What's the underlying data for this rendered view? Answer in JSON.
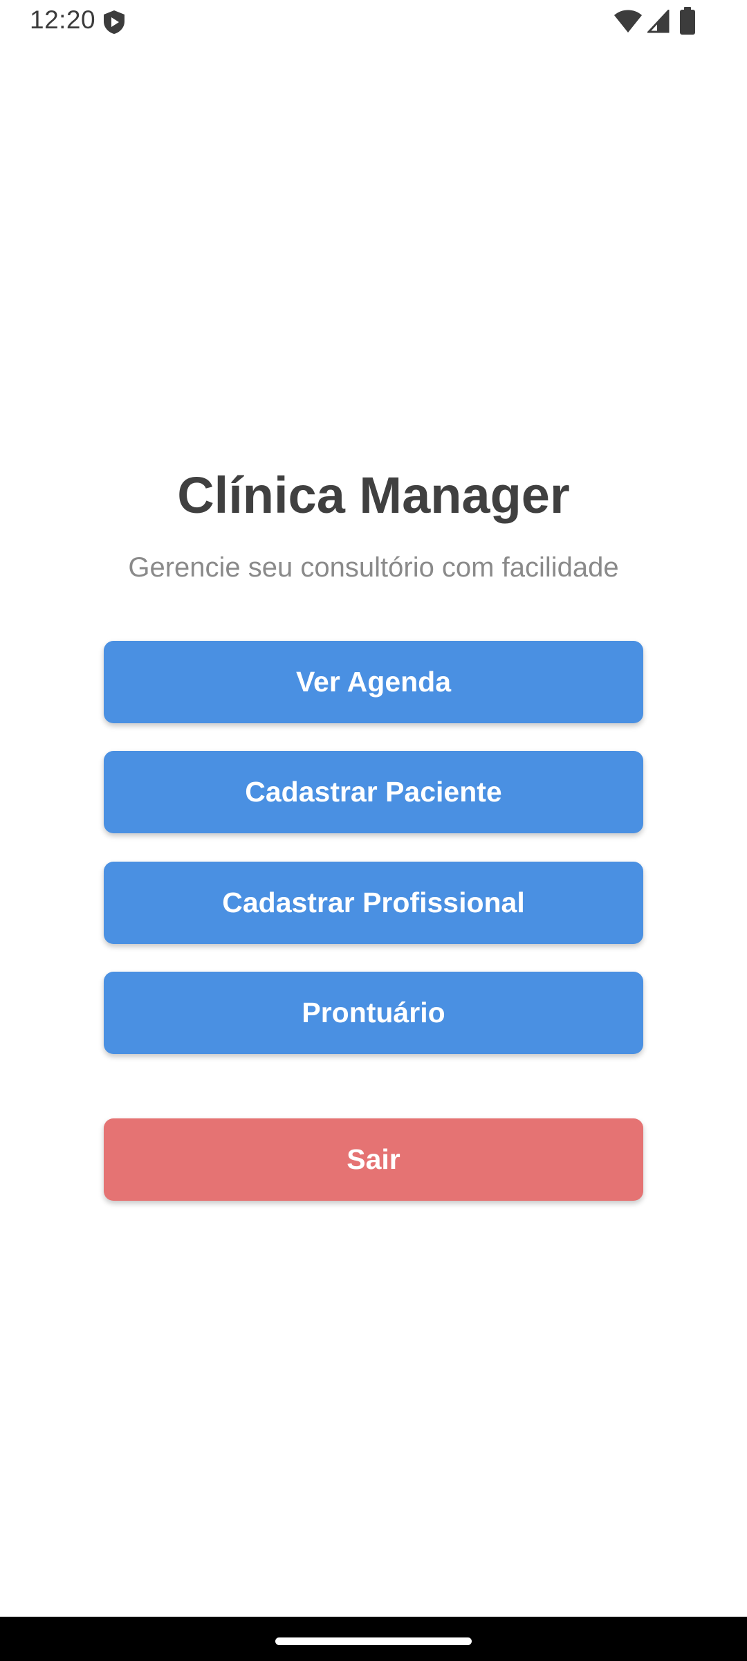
{
  "status_bar": {
    "time": "12:20",
    "icons": [
      "shield-icon",
      "wifi-icon",
      "signal-icon",
      "battery-icon"
    ]
  },
  "app": {
    "title": "Clínica Manager",
    "subtitle": "Gerencie seu consultório com facilidade"
  },
  "menu": {
    "agenda_label": "Ver Agenda",
    "paciente_label": "Cadastrar Paciente",
    "profissional_label": "Cadastrar Profissional",
    "prontuario_label": "Prontuário",
    "sair_label": "Sair"
  },
  "colors": {
    "primary": "#4a90e2",
    "danger": "#e57373",
    "title": "#404040",
    "subtitle": "#8a8a8a"
  }
}
